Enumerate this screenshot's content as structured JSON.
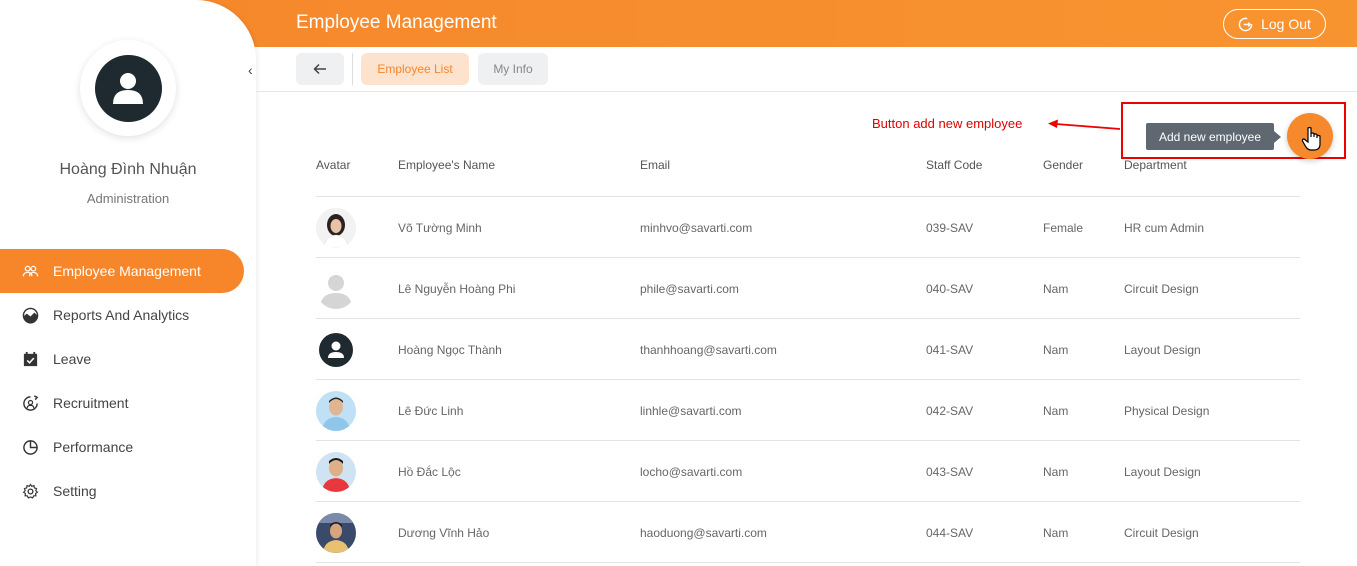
{
  "header": {
    "title": "Employee Management",
    "logout_label": "Log Out"
  },
  "sidebar": {
    "user_name": "Hoàng Đình Nhuận",
    "user_role": "Administration",
    "items": [
      {
        "label": "Employee Management",
        "icon": "users-icon",
        "active": true
      },
      {
        "label": "Reports And Analytics",
        "icon": "chart-icon",
        "active": false
      },
      {
        "label": "Leave",
        "icon": "calendar-check-icon",
        "active": false
      },
      {
        "label": "Recruitment",
        "icon": "recruit-icon",
        "active": false
      },
      {
        "label": "Performance",
        "icon": "pie-icon",
        "active": false
      },
      {
        "label": "Setting",
        "icon": "gear-icon",
        "active": false
      }
    ]
  },
  "toolbar": {
    "tabs": [
      {
        "label": "Employee List",
        "active": true
      },
      {
        "label": "My Info",
        "active": false
      }
    ]
  },
  "annotation": {
    "text": "Button add new employee"
  },
  "add_button": {
    "tooltip": "Add new employee"
  },
  "table": {
    "headers": [
      "Avatar",
      "Employee's Name",
      "Email",
      "Staff Code",
      "Gender",
      "Department"
    ],
    "rows": [
      {
        "avatar": "woman-photo",
        "name": "Võ Tường Minh",
        "email": "minhvo@savarti.com",
        "code": "039-SAV",
        "gender": "Female",
        "dept": "HR cum Admin"
      },
      {
        "avatar": "placeholder-gray",
        "name": "Lê Nguyễn Hoàng Phi",
        "email": "phile@savarti.com",
        "code": "040-SAV",
        "gender": "Nam",
        "dept": "Circuit Design"
      },
      {
        "avatar": "placeholder-dark",
        "name": "Hoàng Ngọc Thành",
        "email": "thanhhoang@savarti.com",
        "code": "041-SAV",
        "gender": "Nam",
        "dept": "Layout Design"
      },
      {
        "avatar": "man-photo-blue",
        "name": "Lê Đức Linh",
        "email": "linhle@savarti.com",
        "code": "042-SAV",
        "gender": "Nam",
        "dept": "Physical Design"
      },
      {
        "avatar": "man-photo-red",
        "name": "Hồ Đắc Lộc",
        "email": "locho@savarti.com",
        "code": "043-SAV",
        "gender": "Nam",
        "dept": "Layout Design"
      },
      {
        "avatar": "man-photo-stage",
        "name": "Dương Vĩnh Hảo",
        "email": "haoduong@savarti.com",
        "code": "044-SAV",
        "gender": "Nam",
        "dept": "Circuit Design"
      }
    ]
  },
  "colors": {
    "accent": "#f7862b",
    "annotation": "#dd0000",
    "tooltip_bg": "#5f6770"
  }
}
